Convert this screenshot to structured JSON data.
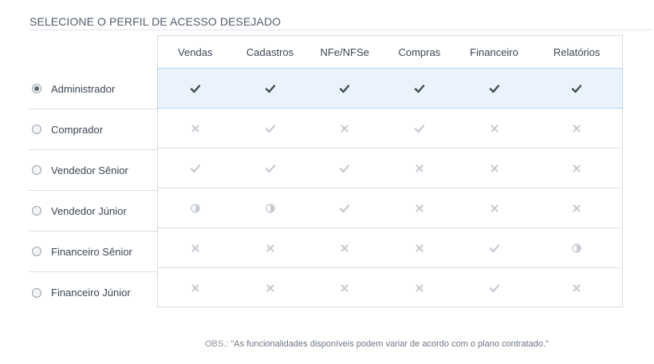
{
  "section_title": "SELECIONE O PERFIL DE ACESSO DESEJADO",
  "columns": [
    "Vendas",
    "Cadastros",
    "NFe/NFSe",
    "Compras",
    "Financeiro",
    "Relatórios"
  ],
  "profiles": [
    {
      "label": "Administrador",
      "selected": true,
      "access": [
        "full",
        "full",
        "full",
        "full",
        "full",
        "full"
      ]
    },
    {
      "label": "Comprador",
      "selected": false,
      "access": [
        "none",
        "full",
        "none",
        "full",
        "none",
        "none"
      ]
    },
    {
      "label": "Vendedor Sênior",
      "selected": false,
      "access": [
        "full",
        "full",
        "full",
        "none",
        "none",
        "none"
      ]
    },
    {
      "label": "Vendedor Júnior",
      "selected": false,
      "access": [
        "partial",
        "partial",
        "full",
        "none",
        "none",
        "none"
      ]
    },
    {
      "label": "Financeiro Sênior",
      "selected": false,
      "access": [
        "none",
        "none",
        "none",
        "none",
        "full",
        "partial"
      ]
    },
    {
      "label": "Financeiro Júnior",
      "selected": false,
      "access": [
        "none",
        "none",
        "none",
        "none",
        "full",
        "none"
      ]
    }
  ],
  "note": {
    "prefix": "OBS.:",
    "text": " \"As funcionalidades disponíveis podem variar de acordo com o plano contratado.\""
  },
  "colors": {
    "check_selected": "#3d4a58",
    "check_muted": "#c6ccd3",
    "cross": "#c6ccd3",
    "selected_row_bg": "#eaf3fc"
  }
}
